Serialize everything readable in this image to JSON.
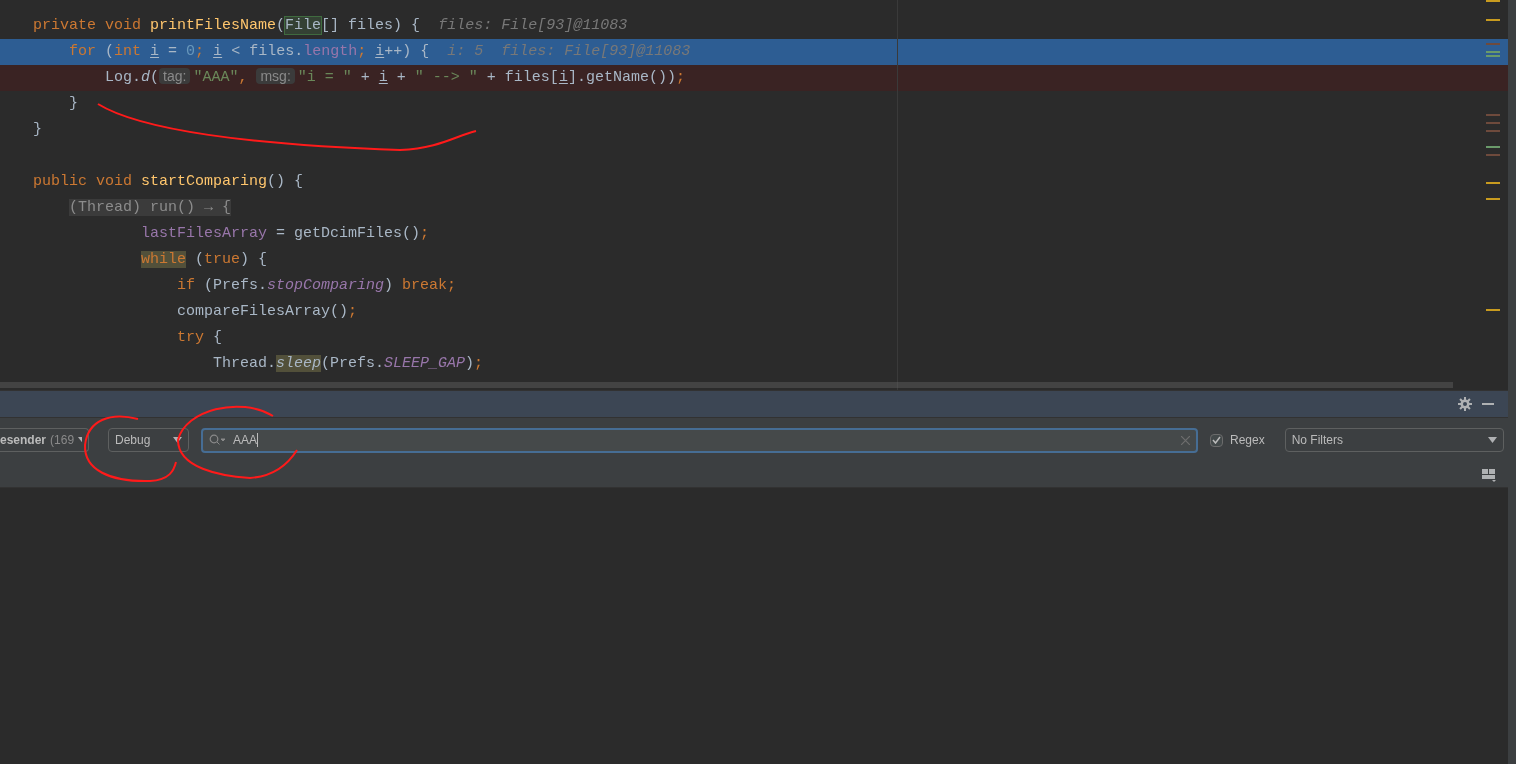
{
  "editor": {
    "lines": [
      {
        "kind": "normal",
        "tokens": [
          {
            "t": "private void ",
            "kind": "kw"
          },
          {
            "t": "printFilesName",
            "kind": "fn"
          },
          {
            "t": "(",
            "kind": "plain"
          },
          {
            "t": "File",
            "kind": "match"
          },
          {
            "t": "[] files) {",
            "kind": "plain"
          },
          {
            "t": "files: File[93]@11083",
            "kind": "hint"
          }
        ],
        "children": [
          {
            "kind": "current",
            "tokens": [
              {
                "t": "for",
                "kind": "kw"
              },
              {
                "t": " (",
                "kind": "plain"
              },
              {
                "t": "int ",
                "kind": "kw"
              },
              {
                "t": "i",
                "kind": "var"
              },
              {
                "t": " = ",
                "kind": "plain"
              },
              {
                "t": "0",
                "kind": "num"
              },
              {
                "t": "; ",
                "kind": "kw"
              },
              {
                "t": "i",
                "kind": "var"
              },
              {
                "t": " < files.",
                "kind": "plain"
              },
              {
                "t": "length",
                "kind": "field"
              },
              {
                "t": "; ",
                "kind": "kw"
              },
              {
                "t": "i",
                "kind": "var"
              },
              {
                "t": "++) {",
                "kind": "plain"
              },
              {
                "t": "i: 5  files: File[93]@11083",
                "kind": "hint"
              }
            ],
            "children": [
              {
                "kind": "breakpoint",
                "tokens": [
                  {
                    "t": "Log.",
                    "kind": "plain"
                  },
                  {
                    "t": "d",
                    "kind": "italic"
                  },
                  {
                    "t": "(",
                    "kind": "plain"
                  },
                  {
                    "t": "tag:",
                    "kind": "param"
                  },
                  {
                    "t": "\"AAA\"",
                    "kind": "str"
                  },
                  {
                    "t": ", ",
                    "kind": "kw"
                  },
                  {
                    "t": "msg:",
                    "kind": "param"
                  },
                  {
                    "t": "\"i = \"",
                    "kind": "str"
                  },
                  {
                    "t": " + ",
                    "kind": "plain"
                  },
                  {
                    "t": "i",
                    "kind": "var"
                  },
                  {
                    "t": " + ",
                    "kind": "plain"
                  },
                  {
                    "t": "\" --> \"",
                    "kind": "str"
                  },
                  {
                    "t": " + files[",
                    "kind": "plain"
                  },
                  {
                    "t": "i",
                    "kind": "var"
                  },
                  {
                    "t": "].getName())",
                    "kind": "plain"
                  },
                  {
                    "t": ";",
                    "kind": "kw"
                  }
                ]
              }
            ]
          },
          {
            "kind": "normal",
            "tokens": [
              {
                "t": "}",
                "kind": "plain"
              }
            ]
          }
        ]
      },
      {
        "kind": "normal",
        "tokens": [
          {
            "t": "}",
            "kind": "plain"
          }
        ]
      },
      {
        "kind": "normal"
      },
      {
        "kind": "normal",
        "tokens": [
          {
            "t": "public void ",
            "kind": "kw"
          },
          {
            "t": "startComparing",
            "kind": "fn"
          },
          {
            "t": "() {",
            "kind": "plain"
          }
        ],
        "children": [
          {
            "kind": "normal",
            "tokens": [
              {
                "t": "(Thread) run() → {",
                "kind": "fold"
              }
            ],
            "children": [
              {
                "children": [
                  {
                    "kind": "normal",
                    "tokens": [
                      {
                        "t": "lastFilesArray",
                        "kind": "field"
                      },
                      {
                        "t": " = getDcimFiles()",
                        "kind": "plain"
                      },
                      {
                        "t": ";",
                        "kind": "kw"
                      }
                    ]
                  },
                  {
                    "kind": "normal",
                    "tokens": [
                      {
                        "t": "while",
                        "kind": "kwmark"
                      },
                      {
                        "t": " (",
                        "kind": "plain"
                      },
                      {
                        "t": "true",
                        "kind": "kw"
                      },
                      {
                        "t": ") {",
                        "kind": "plain"
                      }
                    ],
                    "children": [
                      {
                        "kind": "normal",
                        "tokens": [
                          {
                            "t": "if",
                            "kind": "kw"
                          },
                          {
                            "t": " (Prefs.",
                            "kind": "plain"
                          },
                          {
                            "t": "stopComparing",
                            "kind": "static"
                          },
                          {
                            "t": ") ",
                            "kind": "plain"
                          },
                          {
                            "t": "break;",
                            "kind": "kw"
                          }
                        ]
                      },
                      {
                        "kind": "normal",
                        "tokens": [
                          {
                            "t": "compareFilesArray()",
                            "kind": "plain"
                          },
                          {
                            "t": ";",
                            "kind": "kw"
                          }
                        ]
                      },
                      {
                        "kind": "normal",
                        "tokens": [
                          {
                            "t": "try",
                            "kind": "kw"
                          },
                          {
                            "t": " {",
                            "kind": "plain"
                          }
                        ],
                        "children": [
                          {
                            "kind": "normal",
                            "tokens": [
                              {
                                "t": "Thread.",
                                "kind": "plain"
                              },
                              {
                                "t": "sleep",
                                "kind": "italicmark"
                              },
                              {
                                "t": "(Prefs.",
                                "kind": "plain"
                              },
                              {
                                "t": "SLEEP_GAP",
                                "kind": "static"
                              },
                              {
                                "t": ")",
                                "kind": "plain"
                              },
                              {
                                "t": ";",
                                "kind": "kw"
                              }
                            ]
                          }
                        ]
                      }
                    ]
                  }
                ]
              }
            ]
          }
        ]
      }
    ]
  },
  "logcat": {
    "process": {
      "name": "esender",
      "detail": "(169"
    },
    "level": "Debug",
    "search": {
      "value": "AAA"
    },
    "regex": {
      "label": "Regex",
      "checked": true
    },
    "filter": "No Filters"
  }
}
